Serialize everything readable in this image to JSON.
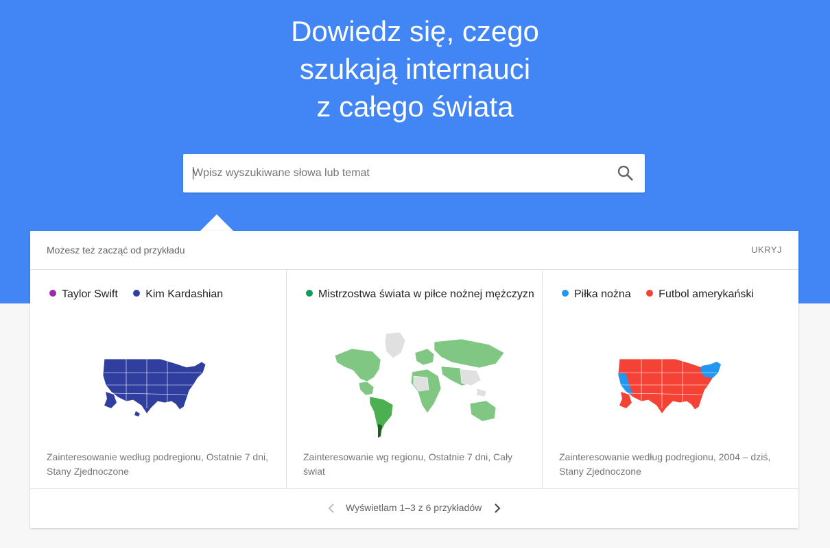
{
  "hero": {
    "title_lines": [
      "Dowiedz się, czego",
      "szukają internauci",
      "z całego świata"
    ]
  },
  "search": {
    "placeholder": "Wpisz wyszukiwane słowa lub temat",
    "icon": "search-icon"
  },
  "examples_panel": {
    "header_label": "Możesz też zacząć od przykładu",
    "hide_label": "UKRYJ",
    "cards": [
      {
        "legend": [
          {
            "label": "Taylor Swift",
            "color": "#9c27b0"
          },
          {
            "label": "Kim Kardashian",
            "color": "#303f9f"
          }
        ],
        "map": "us-map",
        "map_color": "#303f9f",
        "description": "Zainteresowanie według podregionu, Ostatnie 7 dni, Stany Zjednoczone"
      },
      {
        "legend": [
          {
            "label": "Mistrzostwa świata w piłce nożnej mężczyzn",
            "color": "#0f9d58"
          }
        ],
        "map": "world-map",
        "map_color": "#81c784",
        "description": "Zainteresowanie wg regionu, Ostatnie 7 dni, Cały świat"
      },
      {
        "legend": [
          {
            "label": "Piłka nożna",
            "color": "#2196f3"
          },
          {
            "label": "Futbol amerykański",
            "color": "#f44336"
          }
        ],
        "map": "us-map",
        "map_color": "#f44336",
        "description": "Zainteresowanie według podregionu, 2004 – dziś, Stany Zjednoczone"
      }
    ],
    "pagination_label": "Wyświetlam 1–3 z 6 przykładów"
  }
}
